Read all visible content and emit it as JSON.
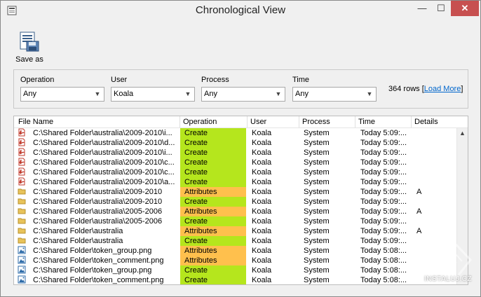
{
  "window": {
    "title": "Chronological View"
  },
  "titlebar_buttons": {
    "minimize": "—",
    "maximize": "☐",
    "close": "✕"
  },
  "toolbar": {
    "save_label": "Save as"
  },
  "filters": {
    "operation": {
      "label": "Operation",
      "value": "Any"
    },
    "user": {
      "label": "User",
      "value": "Koala"
    },
    "process": {
      "label": "Process",
      "value": "Any"
    },
    "time": {
      "label": "Time",
      "value": "Any"
    },
    "rows_count": "364 rows [",
    "load_more": "Load More",
    "rows_close": "]"
  },
  "grid": {
    "columns": {
      "file": "File Name",
      "operation": "Operation",
      "user": "User",
      "process": "Process",
      "time": "Time",
      "details": "Details"
    },
    "rows": [
      {
        "icon": "pdf-icon",
        "file": "C:\\Shared Folder\\australia\\2009-2010\\i...",
        "operation": "Create",
        "user": "Koala",
        "process": "System",
        "time": "Today 5:09:...",
        "details": ""
      },
      {
        "icon": "pdf-icon",
        "file": "C:\\Shared Folder\\australia\\2009-2010\\d...",
        "operation": "Create",
        "user": "Koala",
        "process": "System",
        "time": "Today 5:09:...",
        "details": ""
      },
      {
        "icon": "pdf-icon",
        "file": "C:\\Shared Folder\\australia\\2009-2010\\i...",
        "operation": "Create",
        "user": "Koala",
        "process": "System",
        "time": "Today 5:09:...",
        "details": ""
      },
      {
        "icon": "pdf-icon",
        "file": "C:\\Shared Folder\\australia\\2009-2010\\c...",
        "operation": "Create",
        "user": "Koala",
        "process": "System",
        "time": "Today 5:09:...",
        "details": ""
      },
      {
        "icon": "pdf-icon",
        "file": "C:\\Shared Folder\\australia\\2009-2010\\c...",
        "operation": "Create",
        "user": "Koala",
        "process": "System",
        "time": "Today 5:09:...",
        "details": ""
      },
      {
        "icon": "pdf-icon",
        "file": "C:\\Shared Folder\\australia\\2009-2010\\a...",
        "operation": "Create",
        "user": "Koala",
        "process": "System",
        "time": "Today 5:09:...",
        "details": ""
      },
      {
        "icon": "folder-icon",
        "file": "C:\\Shared Folder\\australia\\2009-2010",
        "operation": "Attributes",
        "user": "Koala",
        "process": "System",
        "time": "Today 5:09:...",
        "details": "A"
      },
      {
        "icon": "folder-icon",
        "file": "C:\\Shared Folder\\australia\\2009-2010",
        "operation": "Create",
        "user": "Koala",
        "process": "System",
        "time": "Today 5:09:...",
        "details": ""
      },
      {
        "icon": "folder-icon",
        "file": "C:\\Shared Folder\\australia\\2005-2006",
        "operation": "Attributes",
        "user": "Koala",
        "process": "System",
        "time": "Today 5:09:...",
        "details": "A"
      },
      {
        "icon": "folder-icon",
        "file": "C:\\Shared Folder\\australia\\2005-2006",
        "operation": "Create",
        "user": "Koala",
        "process": "System",
        "time": "Today 5:09:...",
        "details": ""
      },
      {
        "icon": "folder-icon",
        "file": "C:\\Shared Folder\\australia",
        "operation": "Attributes",
        "user": "Koala",
        "process": "System",
        "time": "Today 5:09:...",
        "details": "A"
      },
      {
        "icon": "folder-icon",
        "file": "C:\\Shared Folder\\australia",
        "operation": "Create",
        "user": "Koala",
        "process": "System",
        "time": "Today 5:09:...",
        "details": ""
      },
      {
        "icon": "image-icon",
        "file": "C:\\Shared Folder\\token_group.png",
        "operation": "Attributes",
        "user": "Koala",
        "process": "System",
        "time": "Today 5:08:...",
        "details": ""
      },
      {
        "icon": "image-icon",
        "file": "C:\\Shared Folder\\token_comment.png",
        "operation": "Attributes",
        "user": "Koala",
        "process": "System",
        "time": "Today 5:08:...",
        "details": ""
      },
      {
        "icon": "image-icon",
        "file": "C:\\Shared Folder\\token_group.png",
        "operation": "Create",
        "user": "Koala",
        "process": "System",
        "time": "Today 5:08:...",
        "details": ""
      },
      {
        "icon": "image-icon",
        "file": "C:\\Shared Folder\\token_comment.png",
        "operation": "Create",
        "user": "Koala",
        "process": "System",
        "time": "Today 5:08:...",
        "details": ""
      }
    ]
  },
  "colors": {
    "create": "#b5e61d",
    "attributes": "#ffc04d",
    "pdf": "#c0392b",
    "folder": "#e8c35a",
    "image": "#2b6aa8",
    "close_button": "#c75050"
  },
  "watermark": {
    "text": "INSTALUJ.CZ"
  }
}
